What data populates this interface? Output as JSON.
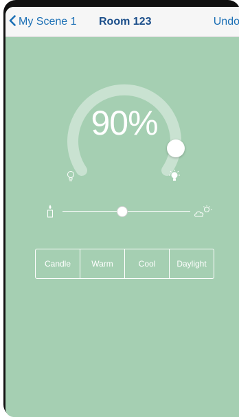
{
  "navbar": {
    "back_label": "My Scene 1",
    "title": "Room 123",
    "undo_label": "Undo"
  },
  "dial": {
    "brightness_label": "90%",
    "brightness_value": 0.9
  },
  "color_temperature": {
    "position": 0.5
  },
  "presets": [
    "Candle",
    "Warm",
    "Cool",
    "Daylight"
  ],
  "colors": {
    "background": "#a5cfb2",
    "accent": "#1b6fb5"
  }
}
